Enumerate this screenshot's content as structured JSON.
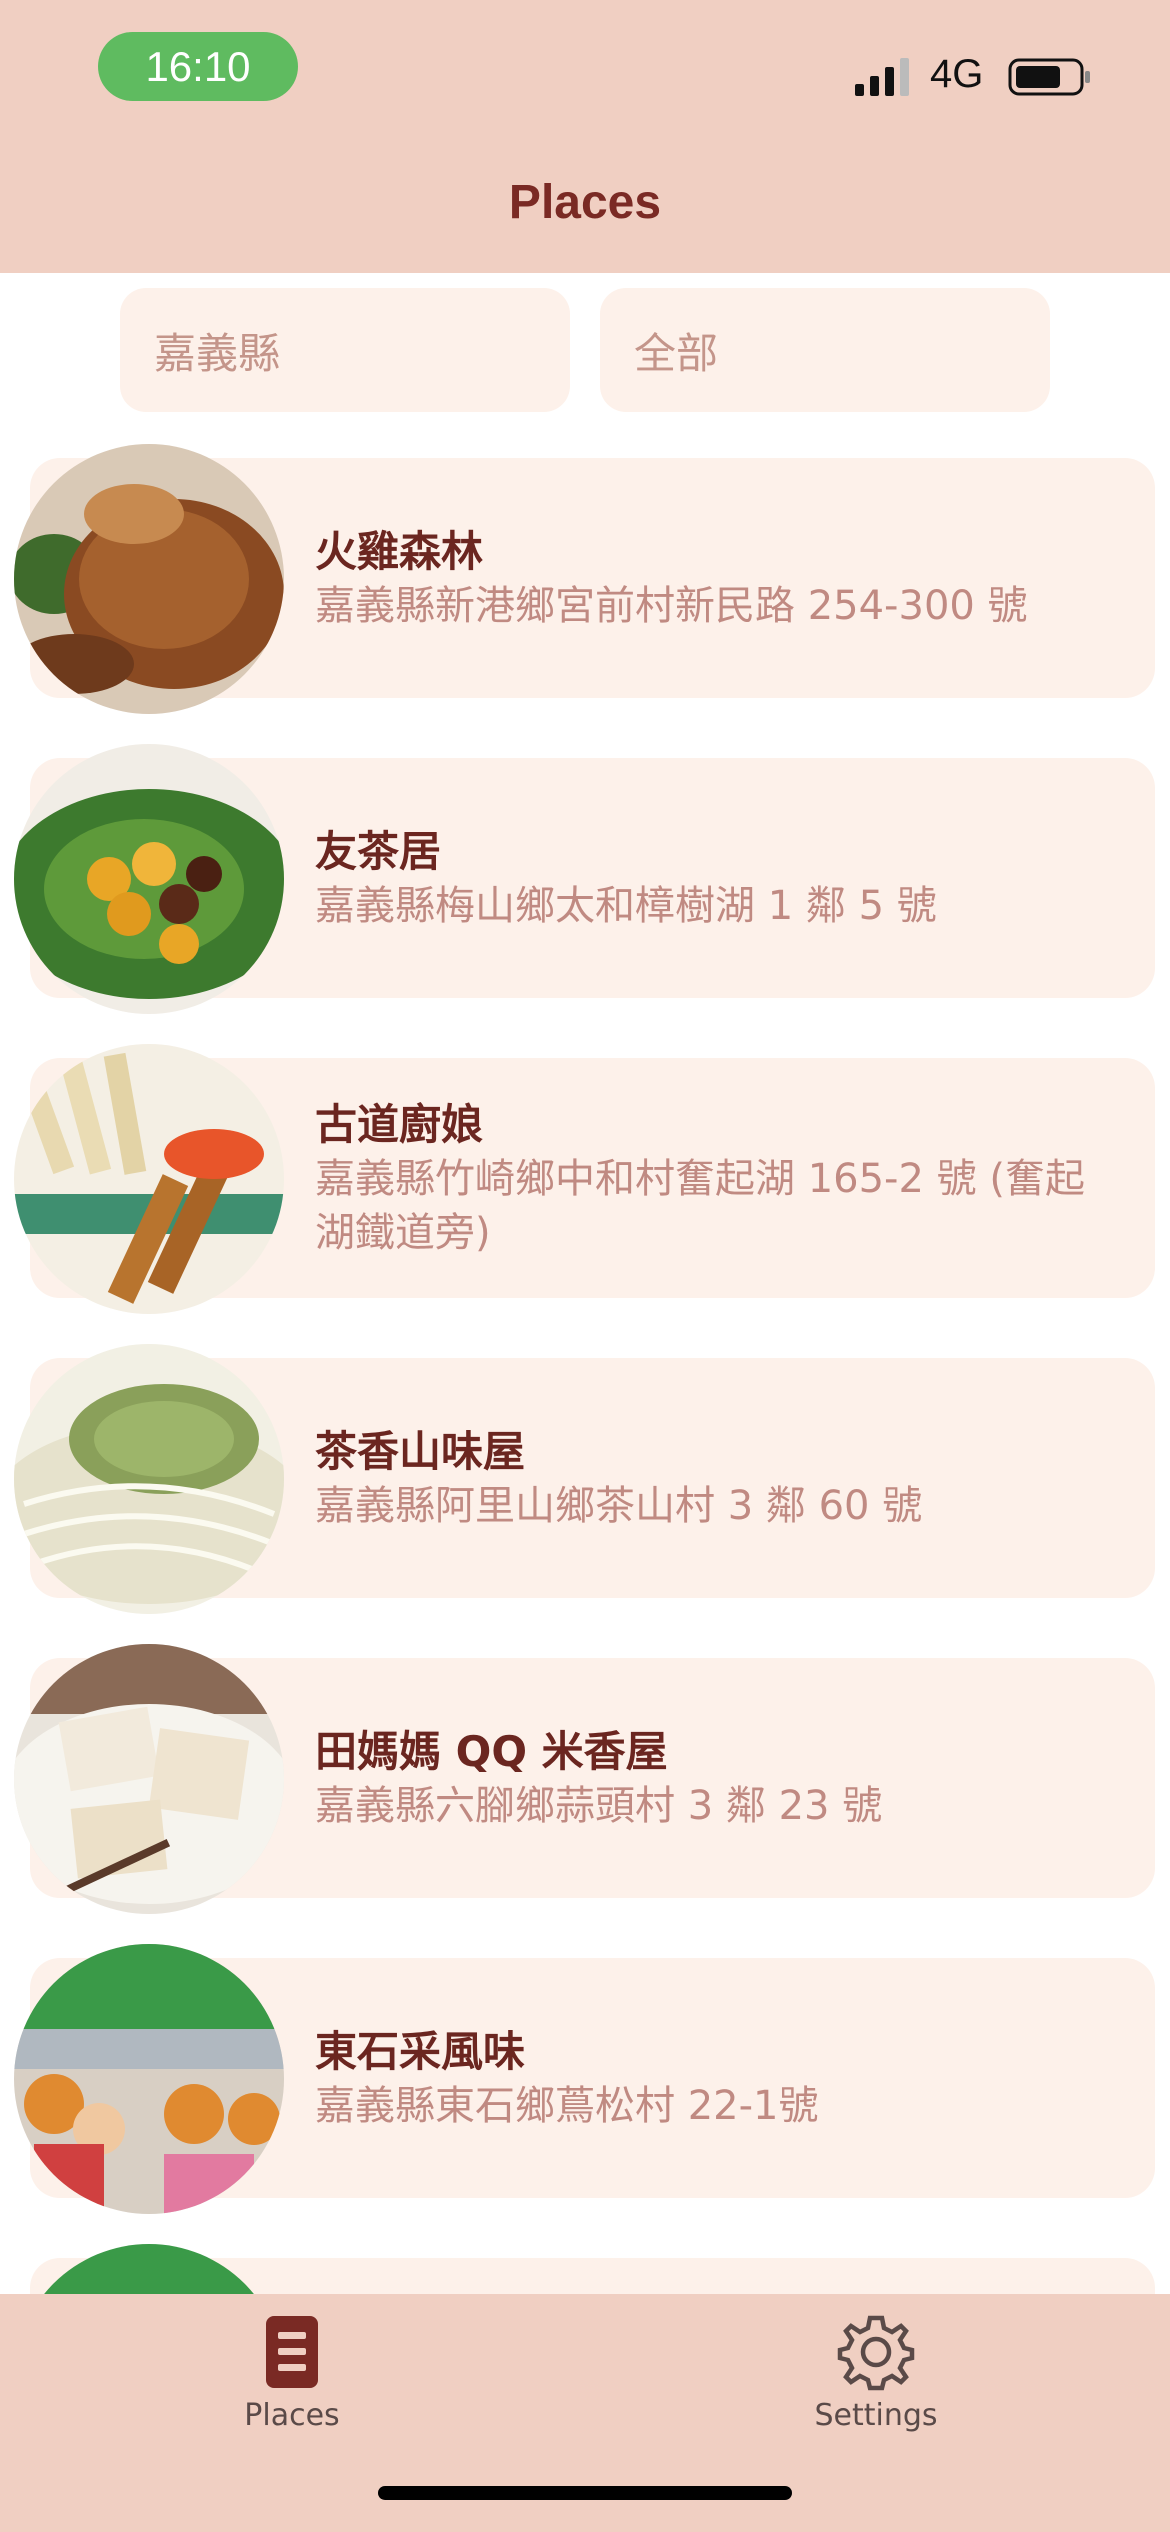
{
  "status_bar": {
    "time": "16:10",
    "network": "4G"
  },
  "nav": {
    "title": "Places"
  },
  "filters": {
    "county": "嘉義縣",
    "category": "全部"
  },
  "places": [
    {
      "name": "火雞森林",
      "address": "嘉義縣新港鄉宮前村新民路 254-300 號"
    },
    {
      "name": "友茶居",
      "address": "嘉義縣梅山鄉太和樟樹湖 1 鄰 5 號"
    },
    {
      "name": "古道廚娘",
      "address": "嘉義縣竹崎鄉中和村奮起湖 165-2 號 (奮起湖鐵道旁)"
    },
    {
      "name": "茶香山味屋",
      "address": "嘉義縣阿里山鄉茶山村 3 鄰 60 號"
    },
    {
      "name": "田媽媽 QQ 米香屋",
      "address": "嘉義縣六腳鄉蒜頭村 3 鄰 23 號"
    },
    {
      "name": "東石采風味",
      "address": "嘉義縣東石鄉蔦松村 22-1號"
    }
  ],
  "tabbar": {
    "places_label": "Places",
    "settings_label": "Settings",
    "places_icon": "list-document-icon",
    "settings_icon": "gear-icon"
  },
  "colors": {
    "header_bg": "#f0cfc2",
    "title": "#7a2a24",
    "card_bg": "#fdf1ea",
    "address_text": "#c08a82",
    "status_pill": "#5fbb60"
  }
}
